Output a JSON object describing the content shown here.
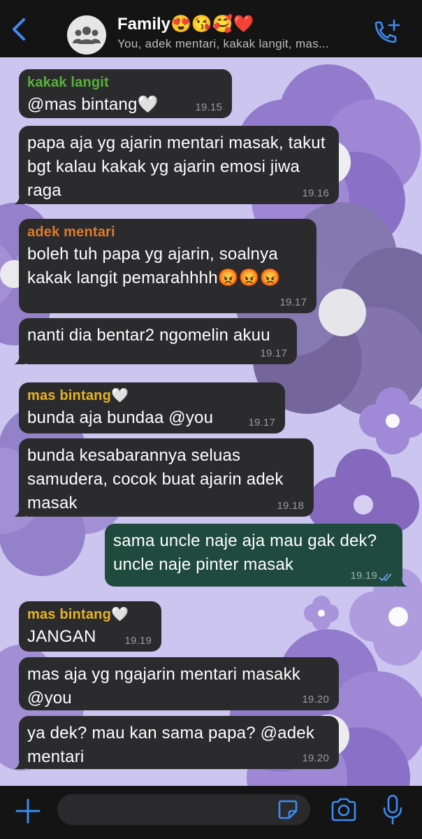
{
  "header": {
    "title": "Family😍😘🥰❤️",
    "subtitle": "You, adek mentari, kakak langit, mas..."
  },
  "colors": {
    "kakak_langit": "#57b13b",
    "adek_mentari": "#e07a2a",
    "mas_bintang": "#e8b323",
    "outgoing_bubble": "#1f4a3d",
    "incoming_bubble": "#2b2b2d",
    "read_ticks": "#6aa2e6"
  },
  "messages": [
    {
      "sender": "kakak langit",
      "text": "@mas bintang🤍",
      "time": "19.15"
    },
    {
      "text": "papa aja yg ajarin mentari masak, takut bgt kalau kakak yg ajarin emosi jiwa raga",
      "time": "19.16"
    },
    {
      "sender": "adek mentari",
      "text": "boleh tuh papa yg ajarin, soalnya kakak langit pemarahhhh😡😡😡",
      "time": "19.17"
    },
    {
      "text": "nanti dia bentar2 ngomelin akuu",
      "time": "19.17"
    },
    {
      "sender": "mas bintang🤍",
      "text": "bunda aja bundaa @you",
      "time": "19.17"
    },
    {
      "text": "bunda kesabarannya seluas samudera, cocok buat ajarin adek masak",
      "time": "19.18"
    },
    {
      "text": "sama uncle naje aja mau gak dek? uncle naje pinter masak",
      "time": "19.19",
      "outgoing": true
    },
    {
      "sender": "mas bintang🤍",
      "text": "JANGAN",
      "time": "19.19"
    },
    {
      "text": "mas aja yg ngajarin mentari masakk @you",
      "time": "19.20"
    },
    {
      "text": "ya dek? mau kan sama papa? @adek mentari",
      "time": "19.20"
    }
  ],
  "composer": {
    "placeholder": ""
  }
}
